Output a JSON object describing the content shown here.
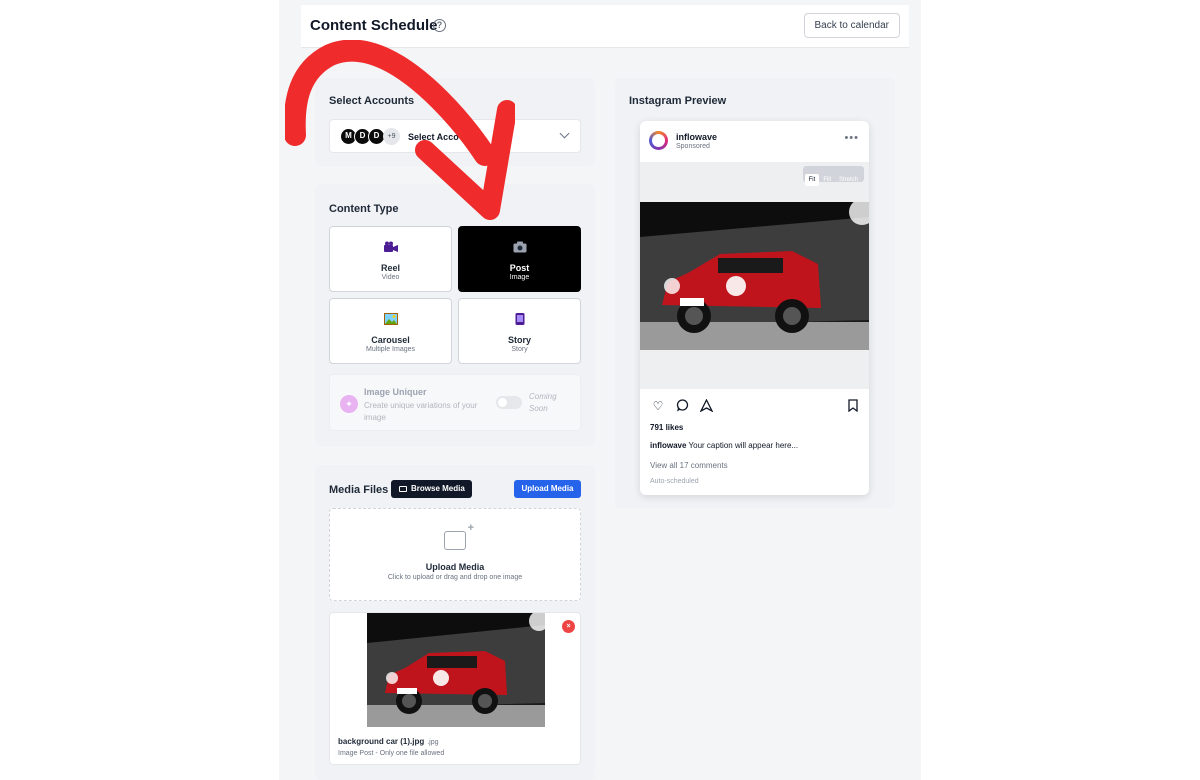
{
  "header": {
    "title": "Content Schedule",
    "help_icon": "?",
    "back_button": "Back to calendar"
  },
  "accounts": {
    "section_title": "Select Accounts",
    "avatars": [
      "M",
      "D",
      "D"
    ],
    "more_count": "+9",
    "placeholder": "Select Acco"
  },
  "content_type": {
    "section_title": "Content Type",
    "options": [
      {
        "label": "Reel",
        "sub": "Video",
        "icon": "video-camera-icon",
        "selected": false
      },
      {
        "label": "Post",
        "sub": "Image",
        "icon": "camera-icon",
        "selected": true
      },
      {
        "label": "Carousel",
        "sub": "Multiple Images",
        "icon": "picture-icon",
        "selected": false
      },
      {
        "label": "Story",
        "sub": "Story",
        "icon": "phone-icon",
        "selected": false
      }
    ],
    "uniquer": {
      "title": "Image Uniquer",
      "description": "Create unique variations of your image",
      "status": "Coming Soon"
    }
  },
  "media": {
    "section_title": "Media Files",
    "browse_button": "Browse Media",
    "upload_button": "Upload Media",
    "dropzone_title": "Upload Media",
    "dropzone_sub": "Click to upload or drag and drop one image",
    "file": {
      "name": "background car (1).jpg",
      "ext": ".jpg",
      "note": "Image Post - Only one file allowed",
      "remove_label": "×"
    }
  },
  "preview": {
    "section_title": "Instagram Preview",
    "account": "inflowave",
    "sponsored": "Sponsored",
    "fit_options": [
      "Fit",
      "Fill",
      "Stretch"
    ],
    "fit_selected": "Fit",
    "likes": "791 likes",
    "caption_user": "inflowave",
    "caption_text": "Your caption will appear here...",
    "comments": "View all 17 comments",
    "auto": "Auto-scheduled"
  },
  "colors": {
    "accent_blue": "#2563eb",
    "dark": "#111827",
    "arrow_red": "#ef2b2b",
    "car_red": "#c0141c"
  }
}
